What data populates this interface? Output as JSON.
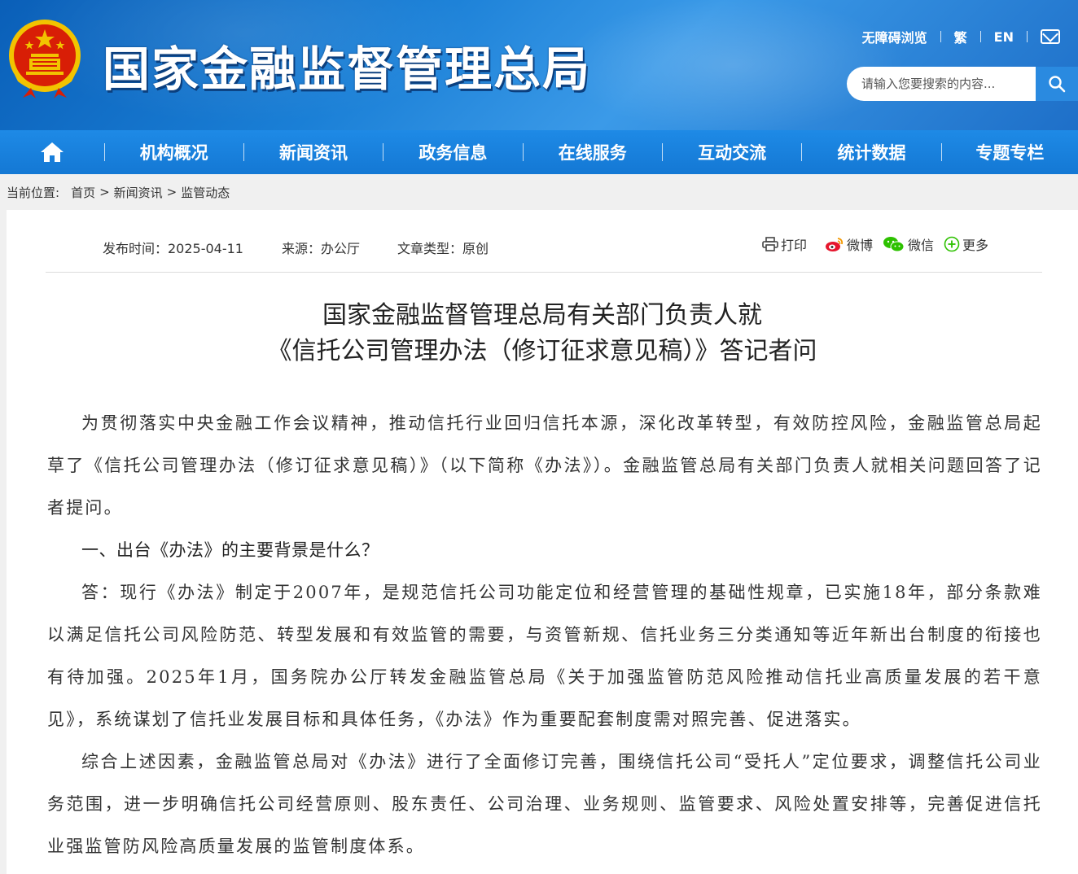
{
  "header": {
    "site_title": "国家金融监督管理总局",
    "links": {
      "accessibility": "无障碍浏览",
      "traditional": "繁",
      "english": "EN"
    },
    "search": {
      "placeholder": "请输入您要搜索的内容..."
    }
  },
  "nav": {
    "items": [
      {
        "label": "机构概况"
      },
      {
        "label": "新闻资讯"
      },
      {
        "label": "政务信息"
      },
      {
        "label": "在线服务"
      },
      {
        "label": "互动交流"
      },
      {
        "label": "统计数据"
      },
      {
        "label": "专题专栏"
      }
    ]
  },
  "breadcrumb": {
    "prefix": "当前位置:",
    "items": [
      "首页",
      "新闻资讯",
      "监管动态"
    ],
    "separator": ">"
  },
  "article": {
    "meta": {
      "publish_time": "发布时间：2025-04-11",
      "source": "来源：办公厅",
      "type": "文章类型：原创"
    },
    "share": {
      "print": "打印",
      "weibo": "微博",
      "wechat": "微信",
      "more": "更多"
    },
    "title_line1": "国家金融监督管理总局有关部门负责人就",
    "title_line2": "《信托公司管理办法（修订征求意见稿）》答记者问",
    "paragraphs": [
      "为贯彻落实中央金融工作会议精神，推动信托行业回归信托本源，深化改革转型，有效防控风险，金融监管总局起草了《信托公司管理办法（修订征求意见稿）》（以下简称《办法》）。金融监管总局有关部门负责人就相关问题回答了记者提问。",
      "一、出台《办法》的主要背景是什么？",
      "答：现行《办法》制定于2007年，是规范信托公司功能定位和经营管理的基础性规章，已实施18年，部分条款难以满足信托公司风险防范、转型发展和有效监管的需要，与资管新规、信托业务三分类通知等近年新出台制度的衔接也有待加强。2025年1月，国务院办公厅转发金融监管总局《关于加强监管防范风险推动信托业高质量发展的若干意见》，系统谋划了信托业发展目标和具体任务，《办法》作为重要配套制度需对照完善、促进落实。",
      "综合上述因素，金融监管总局对《办法》进行了全面修订完善，围绕信托公司“受托人”定位要求，调整信托公司业务范围，进一步明确信托公司经营原则、股东责任、公司治理、业务规则、监管要求、风险处置安排等，完善促进信托业强监管防风险高质量发展的监管制度体系。"
    ]
  },
  "colors": {
    "header_blue": "#1a7fd6",
    "nav_blue": "#1478d4",
    "emblem_red": "#d81e06",
    "emblem_gold": "#f2c300"
  }
}
